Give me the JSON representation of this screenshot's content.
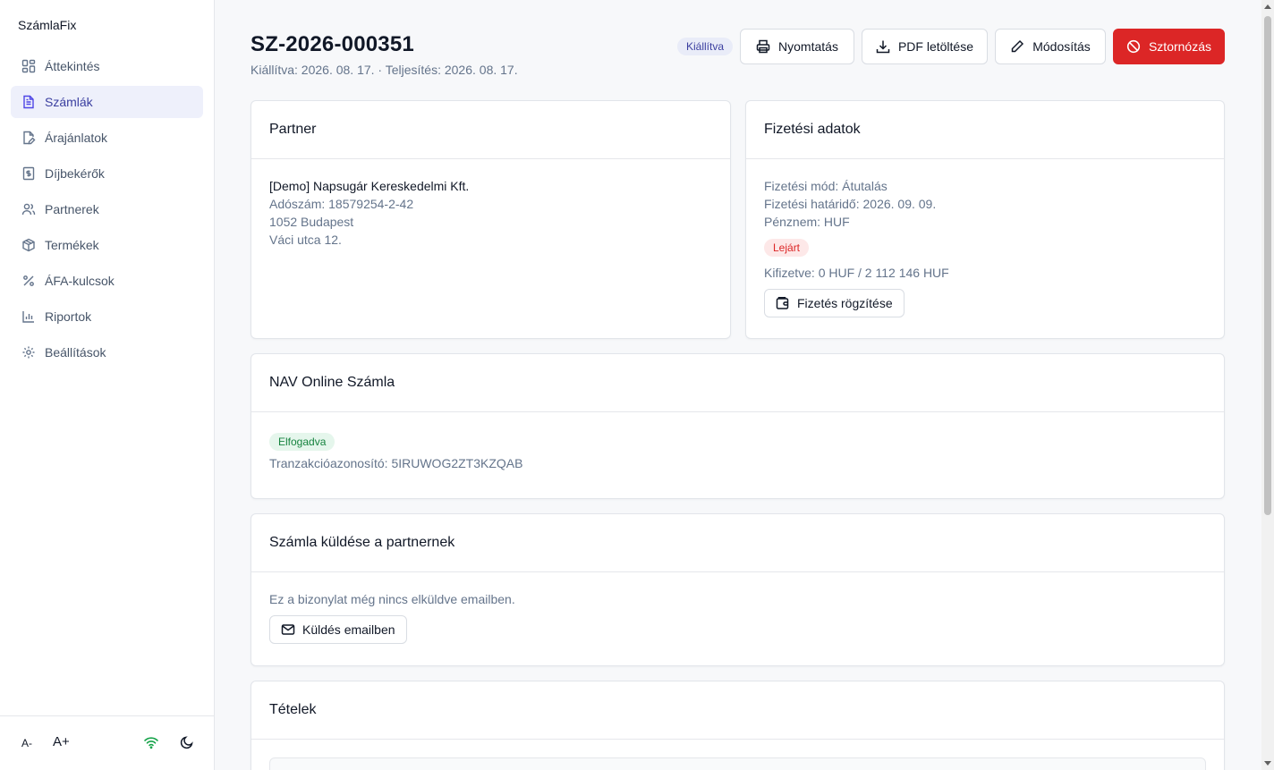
{
  "app": {
    "brand": "SzámlaFix"
  },
  "sidebar": {
    "items": [
      {
        "label": "Áttekintés",
        "icon": "dashboard-icon",
        "active": false
      },
      {
        "label": "Számlák",
        "icon": "file-text-icon",
        "active": true
      },
      {
        "label": "Árajánlatok",
        "icon": "file-edit-icon",
        "active": false
      },
      {
        "label": "Díjbekérők",
        "icon": "receipt-icon",
        "active": false
      },
      {
        "label": "Partnerek",
        "icon": "users-icon",
        "active": false
      },
      {
        "label": "Termékek",
        "icon": "box-icon",
        "active": false
      },
      {
        "label": "ÁFA-kulcsok",
        "icon": "percent-icon",
        "active": false
      },
      {
        "label": "Riportok",
        "icon": "bar-chart-icon",
        "active": false
      },
      {
        "label": "Beállítások",
        "icon": "gear-icon",
        "active": false
      }
    ],
    "footer": {
      "font_decrease": "A-",
      "font_increase": "A+",
      "online_icon": "wifi-icon",
      "theme_icon": "moon-icon"
    }
  },
  "invoice": {
    "number": "SZ-2026-000351",
    "subtitle": "Kiállítva: 2026. 08. 17. · Teljesítés: 2026. 08. 17.",
    "status": "Kiállítva"
  },
  "actions": {
    "print": "Nyomtatás",
    "pdf": "PDF letöltése",
    "edit": "Módosítás",
    "storno": "Sztornózás"
  },
  "partner": {
    "title": "Partner",
    "name": "[Demo] Napsugár Kereskedelmi Kft.",
    "tax": "Adószám: 18579254-2-42",
    "city": "1052 Budapest",
    "street": "Váci utca 12."
  },
  "payment": {
    "title": "Fizetési adatok",
    "method": "Fizetési mód: Átutalás",
    "due": "Fizetési határidő: 2026. 09. 09.",
    "currency": "Pénznem: HUF",
    "status": "Lejárt",
    "paid": "Kifizetve: 0 HUF / 2 112 146 HUF",
    "record_button": "Fizetés rögzítése"
  },
  "nav_online": {
    "title": "NAV Online Számla",
    "status": "Elfogadva",
    "transaction": "Tranzakcióazonosító: 5IRUWOG2ZT3KZQAB"
  },
  "send": {
    "title": "Számla küldése a partnernek",
    "info": "Ez a bizonylat még nincs elküldve emailben.",
    "button": "Küldés emailben"
  },
  "items": {
    "title": "Tételek"
  },
  "colors": {
    "accent": "#4f46e5",
    "danger": "#dc2626",
    "success": "#16833f",
    "online": "#16a34a"
  }
}
